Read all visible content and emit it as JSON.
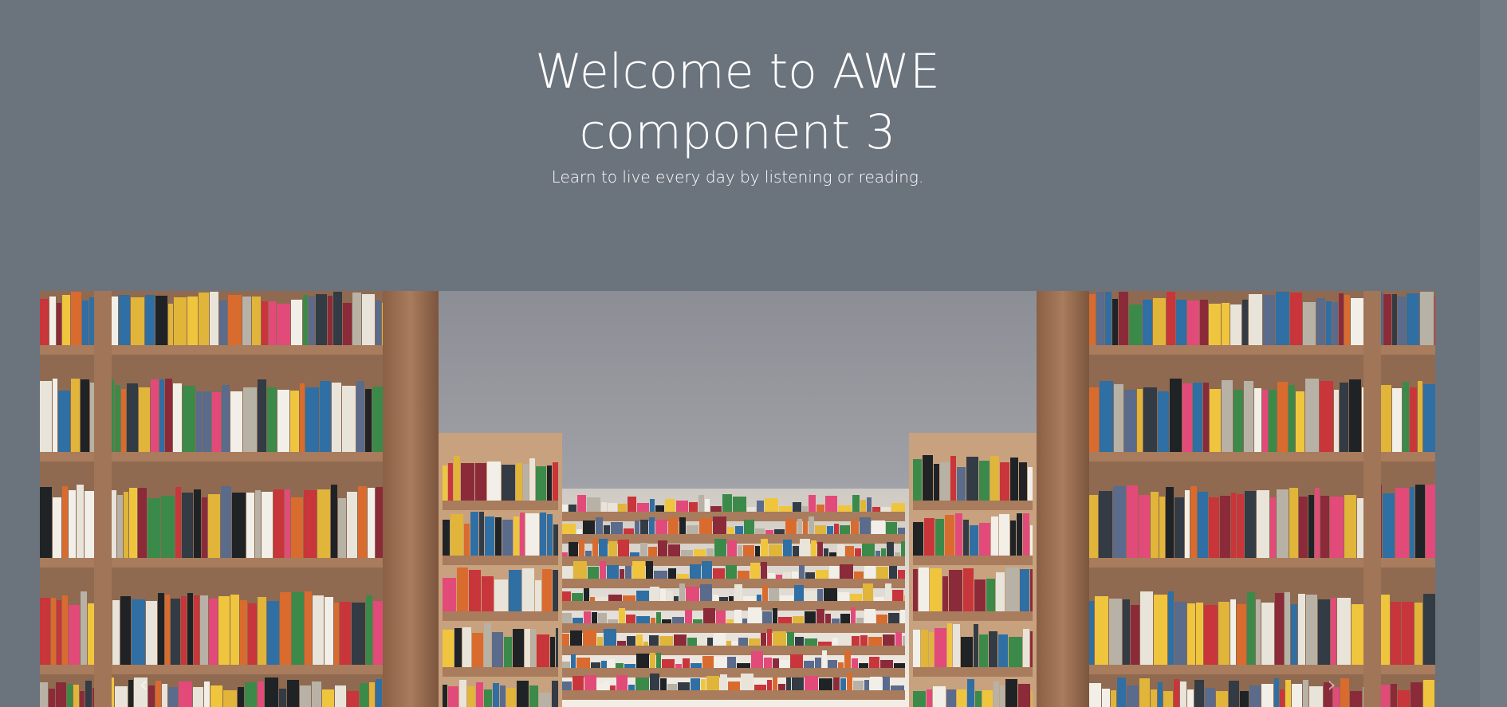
{
  "hero": {
    "title_line1": "Welcome to AWE",
    "title_line2": "component 3",
    "subtitle": "Learn to live every day by listening or reading."
  },
  "carousel": {
    "image_icon": "library-bookshelves-image",
    "prev_icon": "chevron-left-icon",
    "next_icon": "chevron-right-icon",
    "prev_glyph": "‹",
    "next_glyph": "›"
  },
  "colors": {
    "background": "#6b737d",
    "text": "#ffffff",
    "shelf_wood": "#a57a5a",
    "sky": "#8f9198"
  }
}
